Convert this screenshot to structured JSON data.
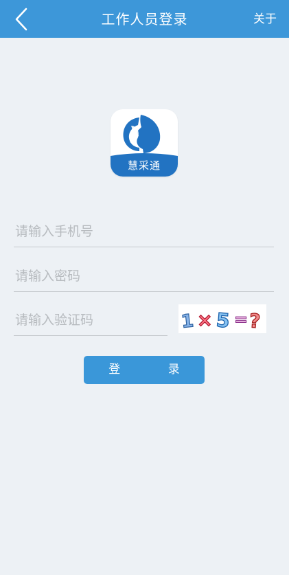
{
  "header": {
    "back_icon": "chevron-left-icon",
    "title": "工作人员登录",
    "about_label": "关于"
  },
  "logo": {
    "text": "慧采通",
    "brand_color": "#2273c2"
  },
  "form": {
    "phone_placeholder": "请输入手机号",
    "password_placeholder": "请输入密码",
    "captcha_placeholder": "请输入验证码",
    "captcha_text": "1×5=?",
    "login_label": "登 录"
  },
  "colors": {
    "header_bg": "#3d97d9",
    "page_bg": "#edf1f5",
    "button_bg": "#3a97d9",
    "divider": "#c5c9cd"
  }
}
